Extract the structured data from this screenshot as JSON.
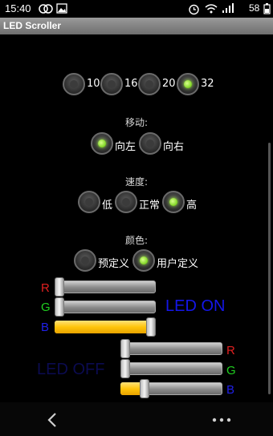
{
  "status_bar": {
    "time": "15:40",
    "battery": "58",
    "icons": [
      "chat-bubbles-icon",
      "gallery-icon",
      "alarm-icon",
      "wifi-icon",
      "signal-icon",
      "battery-icon"
    ]
  },
  "app": {
    "title": "LED Scroller"
  },
  "size_group": {
    "options": [
      {
        "label": "10",
        "selected": false
      },
      {
        "label": "16",
        "selected": false
      },
      {
        "label": "20",
        "selected": false
      },
      {
        "label": "32",
        "selected": true
      }
    ]
  },
  "direction_group": {
    "header": "移动:",
    "options": [
      {
        "label": "向左",
        "selected": true
      },
      {
        "label": "向右",
        "selected": false
      }
    ]
  },
  "speed_group": {
    "header": "速度:",
    "options": [
      {
        "label": "低",
        "selected": false
      },
      {
        "label": "正常",
        "selected": false
      },
      {
        "label": "高",
        "selected": true
      }
    ]
  },
  "color_group": {
    "header": "颜色:",
    "options": [
      {
        "label": "预定义",
        "selected": false
      },
      {
        "label": "用户定义",
        "selected": true
      }
    ]
  },
  "on_color": {
    "preview_text": "LED ON",
    "channels": [
      {
        "label": "R",
        "value": 0.0
      },
      {
        "label": "G",
        "value": 0.0
      },
      {
        "label": "B",
        "value": 1.0
      }
    ]
  },
  "off_color": {
    "preview_text": "LED OFF",
    "channels": [
      {
        "label": "R",
        "value": 0.0
      },
      {
        "label": "G",
        "value": 0.0
      },
      {
        "label": "B",
        "value": 0.21
      }
    ]
  },
  "colors": {
    "red_label": "#e02020",
    "green_label": "#20d020",
    "blue_label": "#2020e8",
    "accent_fill": "#ffc40a",
    "radio_on": "#7cd320",
    "led_on_text": "#1416e8",
    "led_off_text": "#0b0b50"
  },
  "nav": {
    "icons": [
      "back-icon",
      "more-icon"
    ]
  }
}
